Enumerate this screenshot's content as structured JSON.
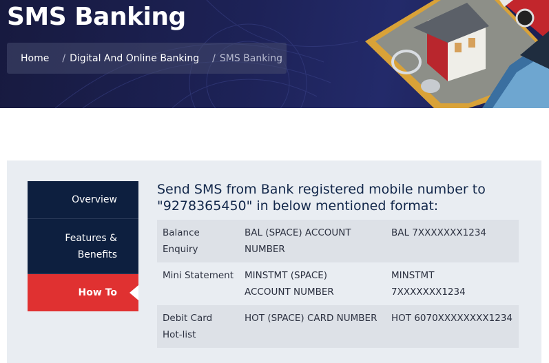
{
  "header": {
    "title": "SMS Banking",
    "breadcrumb": {
      "home": "Home",
      "separator": "/",
      "section": "Digital And Online Banking",
      "current": "SMS Banking"
    }
  },
  "sidebar": {
    "tabs": [
      {
        "label": "Overview",
        "active": false
      },
      {
        "label_line1": "Features &",
        "label_line2": "Benefits",
        "active": false
      },
      {
        "label": "How To",
        "active": true
      }
    ]
  },
  "main": {
    "heading_line1": "Send SMS from Bank registered mobile number to",
    "heading_line2": "\"9278365450\" in below mentioned format:",
    "rows": [
      {
        "service_line1": "Balance",
        "service_line2": "Enquiry",
        "format_line1": "BAL (SPACE) ACCOUNT",
        "format_line2": "NUMBER",
        "example_line1": "BAL 7XXXXXXX1234",
        "example_line2": ""
      },
      {
        "service_line1": "Mini Statement",
        "service_line2": "",
        "format_line1": "MINSTMT (SPACE)",
        "format_line2": "ACCOUNT NUMBER",
        "example_line1": "MINSTMT",
        "example_line2": "7XXXXXXX1234"
      },
      {
        "service_line1": "Debit Card",
        "service_line2": "Hot-list",
        "format_line1": "HOT (SPACE) CARD NUMBER",
        "format_line2": "",
        "example_line1": "HOT 6070XXXXXXXX1234",
        "example_line2": ""
      }
    ]
  },
  "colors": {
    "banner": "#1d2257",
    "tab_bg": "#0d1f3f",
    "tab_active": "#e03131",
    "panel_bg": "#e9edf2",
    "row_shade": "#dde1e7",
    "heading": "#12274a"
  }
}
